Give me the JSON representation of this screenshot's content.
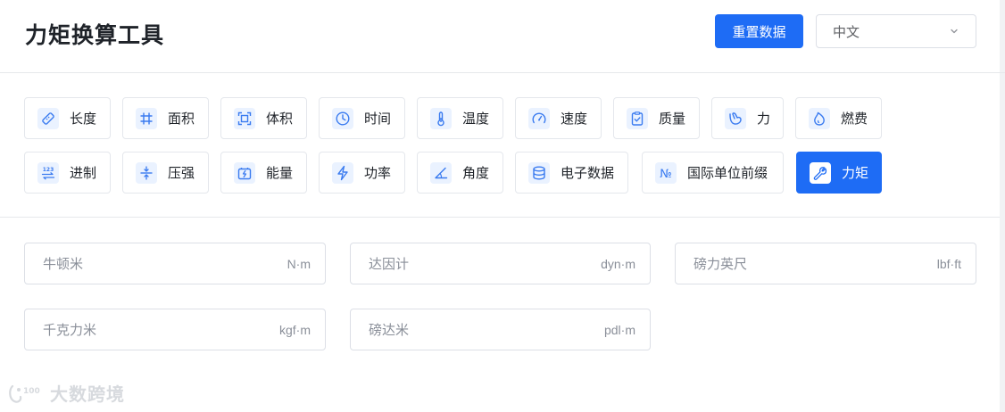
{
  "header": {
    "title": "力矩换算工具",
    "reset_label": "重置数据",
    "language": "中文"
  },
  "categories": [
    {
      "label": "长度",
      "icon": "ruler-icon",
      "active": false
    },
    {
      "label": "面积",
      "icon": "hash-icon",
      "active": false
    },
    {
      "label": "体积",
      "icon": "volume-frame-icon",
      "active": false
    },
    {
      "label": "时间",
      "icon": "clock-icon",
      "active": false
    },
    {
      "label": "温度",
      "icon": "thermometer-icon",
      "active": false
    },
    {
      "label": "速度",
      "icon": "speedometer-icon",
      "active": false
    },
    {
      "label": "质量",
      "icon": "clipboard-check-icon",
      "active": false
    },
    {
      "label": "力",
      "icon": "arm-icon",
      "active": false
    },
    {
      "label": "燃费",
      "icon": "flame-icon",
      "active": false
    },
    {
      "label": "进制",
      "icon": "number-123-icon",
      "active": false
    },
    {
      "label": "压强",
      "icon": "compress-icon",
      "active": false
    },
    {
      "label": "能量",
      "icon": "battery-icon",
      "active": false
    },
    {
      "label": "功率",
      "icon": "lightning-icon",
      "active": false
    },
    {
      "label": "角度",
      "icon": "angle-icon",
      "active": false
    },
    {
      "label": "电子数据",
      "icon": "database-icon",
      "active": false
    },
    {
      "label": "国际单位前缀",
      "icon": "numero-icon",
      "active": false
    },
    {
      "label": "力矩",
      "icon": "wrench-icon",
      "active": true
    }
  ],
  "fields": [
    {
      "placeholder": "牛顿米",
      "unit": "N·m",
      "value": ""
    },
    {
      "placeholder": "达因计",
      "unit": "dyn·m",
      "value": ""
    },
    {
      "placeholder": "磅力英尺",
      "unit": "lbf·ft",
      "value": ""
    },
    {
      "placeholder": "千克力米",
      "unit": "kgf·m",
      "value": ""
    },
    {
      "placeholder": "磅达米",
      "unit": "pdl·m",
      "value": ""
    }
  ],
  "watermark": {
    "text": "大数跨境"
  },
  "colors": {
    "accent": "#1e6cf5",
    "icon_bg": "#eaf2ff",
    "border": "#e4e7ec"
  }
}
